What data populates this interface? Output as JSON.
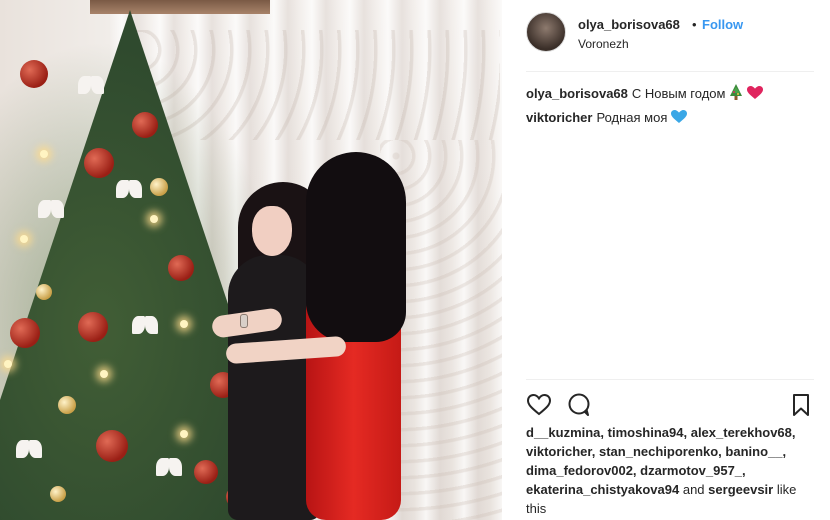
{
  "post": {
    "username": "olya_borisova68",
    "separator": "•",
    "follow_label": "Follow",
    "location": "Voronezh"
  },
  "comments": [
    {
      "user": "olya_borisova68",
      "text": "С Новым годом",
      "emojis": [
        "christmas-tree-icon",
        "red-heart-icon"
      ]
    },
    {
      "user": "viktoricher",
      "text": "Родная моя",
      "emojis": [
        "blue-heart-icon"
      ]
    }
  ],
  "likes": {
    "line1": "d__kuzmina, timoshina94, alex_terekhov68,",
    "line2": "viktoricher, stan_nechiporenko, banino__,",
    "line3": "dima_fedorov002, dzarmotov_957_,",
    "line4_names": "ekaterina_chistyakova94",
    "line4_and": "and",
    "line4_last": "sergeevsir",
    "line4_like": "like",
    "line5": "this"
  },
  "colors": {
    "link": "#3897f0",
    "text": "#262626",
    "divider": "#efefef",
    "heart_red": "#e0245e",
    "heart_blue": "#3aa7e6",
    "dress_red": "#e52a23"
  }
}
